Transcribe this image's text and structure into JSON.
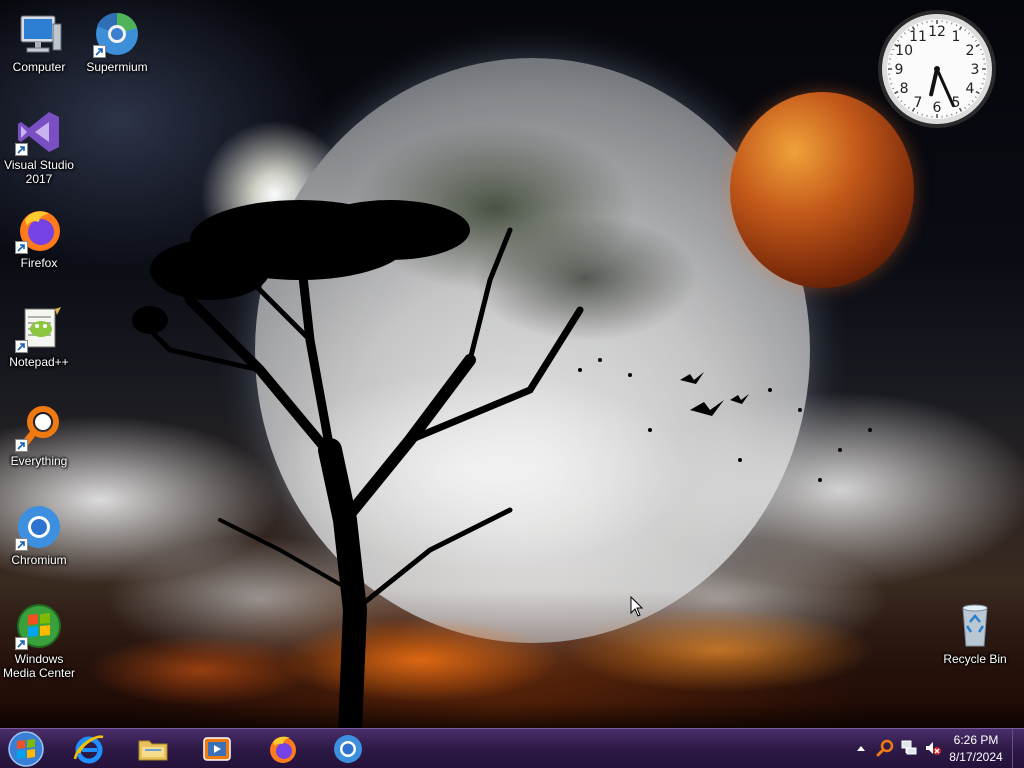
{
  "desktop_icons": [
    {
      "label": "Computer",
      "icon": "computer-icon"
    },
    {
      "label": "Supermium",
      "icon": "supermium-icon"
    },
    {
      "label": "Visual Studio 2017",
      "icon": "visual-studio-icon"
    },
    {
      "label": "Firefox",
      "icon": "firefox-icon"
    },
    {
      "label": "Notepad++",
      "icon": "notepad-plus-plus-icon"
    },
    {
      "label": "Everything",
      "icon": "everything-search-icon"
    },
    {
      "label": "Chromium",
      "icon": "chromium-icon"
    },
    {
      "label": "Windows Media Center",
      "icon": "windows-media-center-icon"
    },
    {
      "label": "Recycle Bin",
      "icon": "recycle-bin-icon"
    }
  ],
  "clock_gadget": {
    "numbers": [
      "12",
      "1",
      "2",
      "3",
      "4",
      "5",
      "6",
      "7",
      "8",
      "9",
      "10",
      "11"
    ],
    "hour": 6,
    "minute": 26
  },
  "taskbar": {
    "pinned": [
      {
        "name": "internet-explorer",
        "icon": "internet-explorer-icon"
      },
      {
        "name": "file-explorer",
        "icon": "folder-icon"
      },
      {
        "name": "media-player",
        "icon": "media-player-icon"
      },
      {
        "name": "firefox",
        "icon": "firefox-icon"
      },
      {
        "name": "chromium",
        "icon": "chromium-icon"
      }
    ],
    "tray": {
      "time": "6:26 PM",
      "date": "8/17/2024",
      "icons": [
        "show-hidden-icons-arrow",
        "everything-search-icon",
        "network-icon",
        "volume-muted-icon"
      ]
    }
  },
  "colors": {
    "taskbar": "#2e1a47",
    "planet": "#c4591a"
  }
}
